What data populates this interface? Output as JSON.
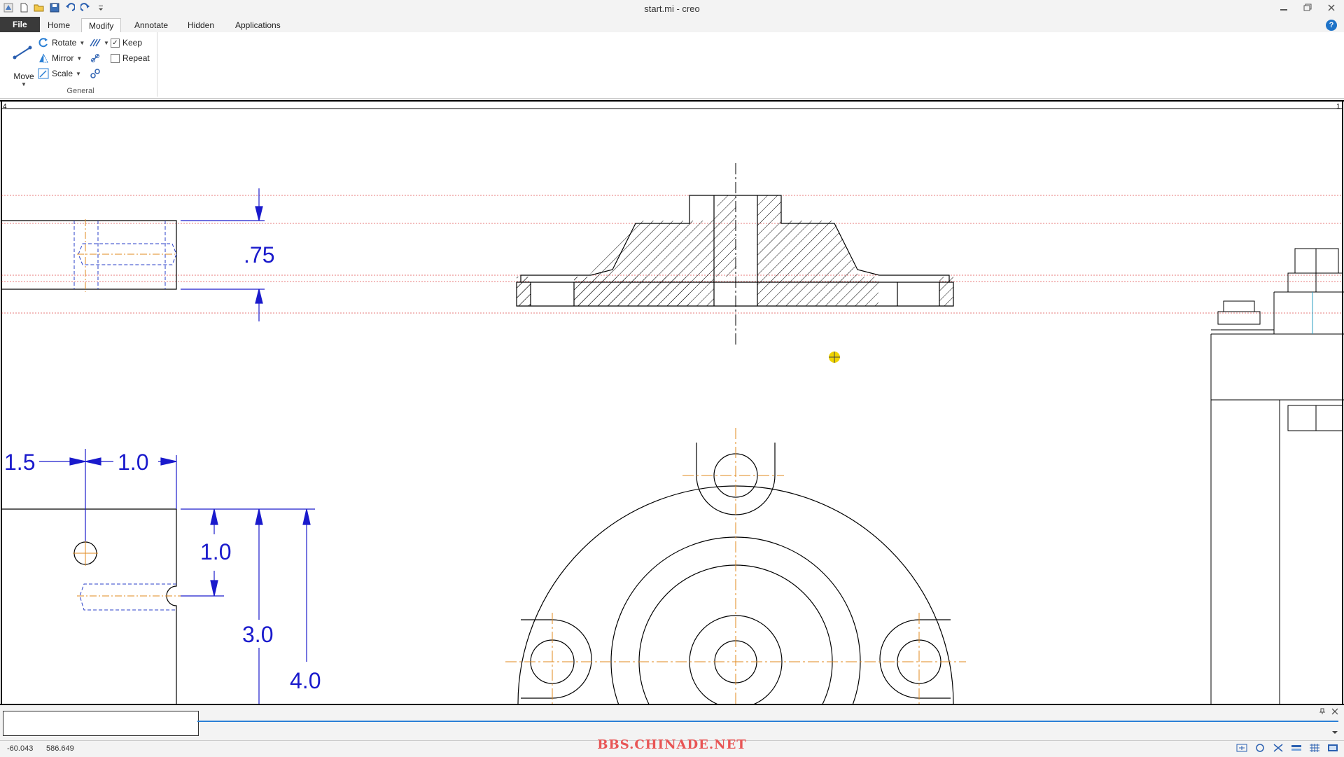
{
  "window": {
    "title": "start.mi - creo",
    "minimize": "▭",
    "restore": "❐",
    "close": "✕"
  },
  "tabs": {
    "file": "File",
    "home": "Home",
    "modify": "Modify",
    "annotate": "Annotate",
    "hidden": "Hidden",
    "applications": "Applications"
  },
  "ribbon": {
    "move": "Move",
    "rotate": "Rotate",
    "mirror": "Mirror",
    "scale": "Scale",
    "keep": "Keep",
    "keep_checked": true,
    "repeat": "Repeat",
    "repeat_checked": false,
    "group_label": "General"
  },
  "drawing": {
    "dims": {
      "top_height": ".75",
      "left_15": "1.5",
      "left_10": "1.0",
      "v_10": "1.0",
      "v_30": "3.0",
      "v_40": "4.0"
    },
    "corner_left": "4",
    "corner_right": "1"
  },
  "status": {
    "x": "-60.043",
    "y": "586.649",
    "watermark": "BBS.CHINADE.NET"
  },
  "colors": {
    "geometry": "#000000",
    "dimension": "#1a1acc",
    "centerline": "#e08a1e",
    "hidden_line": "#2a3fc8",
    "construction": "#e05050",
    "cursor": "#f0d400"
  }
}
